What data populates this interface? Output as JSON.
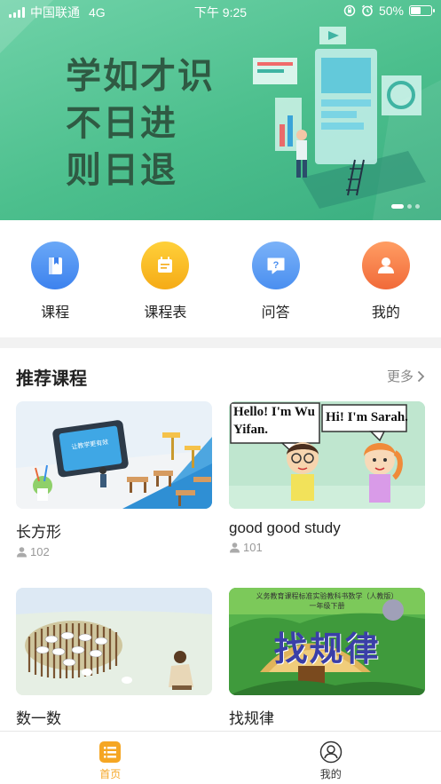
{
  "status_bar": {
    "carrier": "中国联通",
    "network": "4G",
    "time": "下午 9:25",
    "battery_text": "50%",
    "battery_level": 0.5
  },
  "banner": {
    "slogan_lines": [
      "学如才识",
      "不日进",
      "则日退"
    ],
    "slide_count": 3,
    "active_slide": 0
  },
  "quick_nav": [
    {
      "label": "课程",
      "icon": "book-icon",
      "color_from": "#6aa8f7",
      "color_to": "#3d82ee"
    },
    {
      "label": "课程表",
      "icon": "schedule-icon",
      "color_from": "#ffd03a",
      "color_to": "#f5ab16"
    },
    {
      "label": "问答",
      "icon": "question-icon",
      "color_from": "#7bb2f8",
      "color_to": "#4a8ff0"
    },
    {
      "label": "我的",
      "icon": "user-icon",
      "color_from": "#ff9d63",
      "color_to": "#f16a39"
    }
  ],
  "recommended": {
    "title": "推荐课程",
    "more_label": "更多",
    "courses": [
      {
        "title": "长方形",
        "count": "102",
        "thumb": "classroom"
      },
      {
        "title": "good good study",
        "count": "101",
        "thumb": "dialogue",
        "bubble_left": "Hello! I'm Wu Yifan.",
        "bubble_right": "Hi! I'm Sarah."
      },
      {
        "title": "数一数",
        "count": "",
        "thumb": "sheep"
      },
      {
        "title": "找规律",
        "count": "",
        "thumb": "pattern",
        "header_line1": "义务教育课程标准实验教科书数学（人教版）",
        "header_line2": "一年级下册",
        "big_text": "找规律"
      }
    ]
  },
  "tab_bar": {
    "tabs": [
      {
        "label": "首页",
        "icon": "home-icon",
        "active": true
      },
      {
        "label": "我的",
        "icon": "profile-icon",
        "active": false
      }
    ],
    "active_color": "#f5a623",
    "inactive_color": "#333333"
  }
}
